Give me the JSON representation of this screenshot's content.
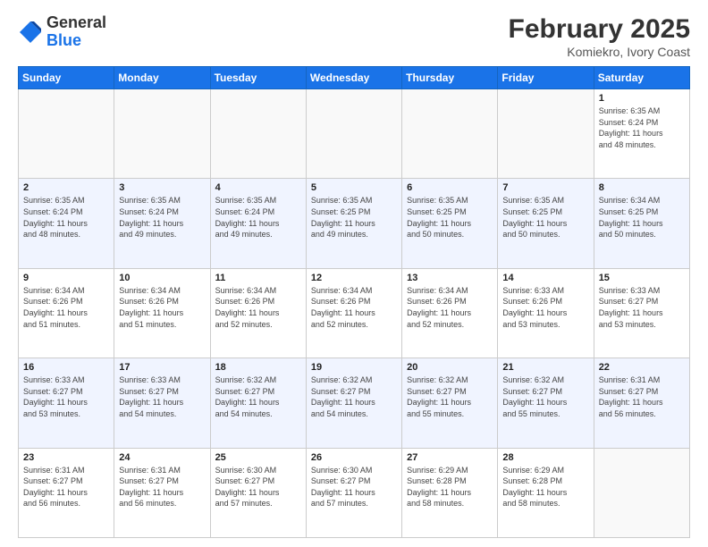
{
  "header": {
    "logo_general": "General",
    "logo_blue": "Blue",
    "month_title": "February 2025",
    "location": "Komiekro, Ivory Coast"
  },
  "days_of_week": [
    "Sunday",
    "Monday",
    "Tuesday",
    "Wednesday",
    "Thursday",
    "Friday",
    "Saturday"
  ],
  "weeks": [
    {
      "shade": "white",
      "days": [
        {
          "num": "",
          "info": ""
        },
        {
          "num": "",
          "info": ""
        },
        {
          "num": "",
          "info": ""
        },
        {
          "num": "",
          "info": ""
        },
        {
          "num": "",
          "info": ""
        },
        {
          "num": "",
          "info": ""
        },
        {
          "num": "1",
          "info": "Sunrise: 6:35 AM\nSunset: 6:24 PM\nDaylight: 11 hours\nand 48 minutes."
        }
      ]
    },
    {
      "shade": "shade",
      "days": [
        {
          "num": "2",
          "info": "Sunrise: 6:35 AM\nSunset: 6:24 PM\nDaylight: 11 hours\nand 48 minutes."
        },
        {
          "num": "3",
          "info": "Sunrise: 6:35 AM\nSunset: 6:24 PM\nDaylight: 11 hours\nand 49 minutes."
        },
        {
          "num": "4",
          "info": "Sunrise: 6:35 AM\nSunset: 6:24 PM\nDaylight: 11 hours\nand 49 minutes."
        },
        {
          "num": "5",
          "info": "Sunrise: 6:35 AM\nSunset: 6:25 PM\nDaylight: 11 hours\nand 49 minutes."
        },
        {
          "num": "6",
          "info": "Sunrise: 6:35 AM\nSunset: 6:25 PM\nDaylight: 11 hours\nand 50 minutes."
        },
        {
          "num": "7",
          "info": "Sunrise: 6:35 AM\nSunset: 6:25 PM\nDaylight: 11 hours\nand 50 minutes."
        },
        {
          "num": "8",
          "info": "Sunrise: 6:34 AM\nSunset: 6:25 PM\nDaylight: 11 hours\nand 50 minutes."
        }
      ]
    },
    {
      "shade": "white",
      "days": [
        {
          "num": "9",
          "info": "Sunrise: 6:34 AM\nSunset: 6:26 PM\nDaylight: 11 hours\nand 51 minutes."
        },
        {
          "num": "10",
          "info": "Sunrise: 6:34 AM\nSunset: 6:26 PM\nDaylight: 11 hours\nand 51 minutes."
        },
        {
          "num": "11",
          "info": "Sunrise: 6:34 AM\nSunset: 6:26 PM\nDaylight: 11 hours\nand 52 minutes."
        },
        {
          "num": "12",
          "info": "Sunrise: 6:34 AM\nSunset: 6:26 PM\nDaylight: 11 hours\nand 52 minutes."
        },
        {
          "num": "13",
          "info": "Sunrise: 6:34 AM\nSunset: 6:26 PM\nDaylight: 11 hours\nand 52 minutes."
        },
        {
          "num": "14",
          "info": "Sunrise: 6:33 AM\nSunset: 6:26 PM\nDaylight: 11 hours\nand 53 minutes."
        },
        {
          "num": "15",
          "info": "Sunrise: 6:33 AM\nSunset: 6:27 PM\nDaylight: 11 hours\nand 53 minutes."
        }
      ]
    },
    {
      "shade": "shade",
      "days": [
        {
          "num": "16",
          "info": "Sunrise: 6:33 AM\nSunset: 6:27 PM\nDaylight: 11 hours\nand 53 minutes."
        },
        {
          "num": "17",
          "info": "Sunrise: 6:33 AM\nSunset: 6:27 PM\nDaylight: 11 hours\nand 54 minutes."
        },
        {
          "num": "18",
          "info": "Sunrise: 6:32 AM\nSunset: 6:27 PM\nDaylight: 11 hours\nand 54 minutes."
        },
        {
          "num": "19",
          "info": "Sunrise: 6:32 AM\nSunset: 6:27 PM\nDaylight: 11 hours\nand 54 minutes."
        },
        {
          "num": "20",
          "info": "Sunrise: 6:32 AM\nSunset: 6:27 PM\nDaylight: 11 hours\nand 55 minutes."
        },
        {
          "num": "21",
          "info": "Sunrise: 6:32 AM\nSunset: 6:27 PM\nDaylight: 11 hours\nand 55 minutes."
        },
        {
          "num": "22",
          "info": "Sunrise: 6:31 AM\nSunset: 6:27 PM\nDaylight: 11 hours\nand 56 minutes."
        }
      ]
    },
    {
      "shade": "white",
      "days": [
        {
          "num": "23",
          "info": "Sunrise: 6:31 AM\nSunset: 6:27 PM\nDaylight: 11 hours\nand 56 minutes."
        },
        {
          "num": "24",
          "info": "Sunrise: 6:31 AM\nSunset: 6:27 PM\nDaylight: 11 hours\nand 56 minutes."
        },
        {
          "num": "25",
          "info": "Sunrise: 6:30 AM\nSunset: 6:27 PM\nDaylight: 11 hours\nand 57 minutes."
        },
        {
          "num": "26",
          "info": "Sunrise: 6:30 AM\nSunset: 6:27 PM\nDaylight: 11 hours\nand 57 minutes."
        },
        {
          "num": "27",
          "info": "Sunrise: 6:29 AM\nSunset: 6:28 PM\nDaylight: 11 hours\nand 58 minutes."
        },
        {
          "num": "28",
          "info": "Sunrise: 6:29 AM\nSunset: 6:28 PM\nDaylight: 11 hours\nand 58 minutes."
        },
        {
          "num": "",
          "info": ""
        }
      ]
    }
  ]
}
